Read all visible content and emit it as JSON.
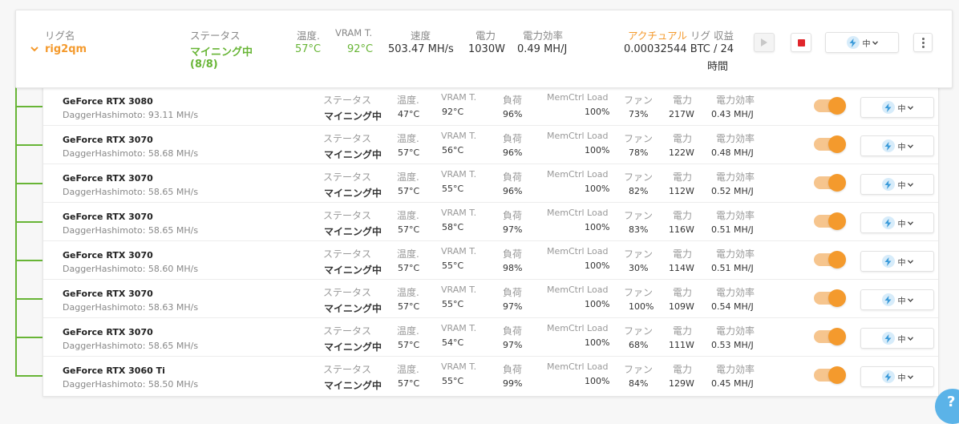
{
  "rig": {
    "name_label": "リグ名",
    "name": "rig2qm",
    "status_label": "ステータス",
    "status": "マイニング中",
    "status_count": "(8/8)",
    "temp_label": "温度.",
    "temp": "57°C",
    "vram_label": "VRAM T.",
    "vram": "92°C",
    "speed_label": "速度",
    "speed": "503.47 MH/s",
    "power_label": "電力",
    "power": "1030W",
    "efficiency_label": "電力効率",
    "efficiency": "0.49 MH/J",
    "profit_label_actual": "アクチュアル",
    "profit_label_rest": " リグ 収益",
    "profit_value": "0.00032544 BTC / 24",
    "profit_unit": "時間",
    "power_mode": "中",
    "play_icon": "play-icon",
    "stop_icon": "stop-icon",
    "more_icon": "vertical-dots-icon"
  },
  "colors": {
    "green": "#68b536",
    "orange": "#f49a2d",
    "stop_red": "#e0252b",
    "bolt_blue": "#3a9ad9"
  },
  "device_labels": {
    "status": "ステータス",
    "temp": "温度.",
    "vram": "VRAM T.",
    "load": "負荷",
    "memctrl": "MemCtrl Load",
    "fan": "ファン",
    "power": "電力",
    "efficiency": "電力効率",
    "power_mode": "中"
  },
  "devices": [
    {
      "name": "GeForce RTX 3080",
      "algo": "DaggerHashimoto: 93.11 MH/s",
      "status": "マイニング中",
      "temp": "47°C",
      "vram": "92°C",
      "load": "96%",
      "memctrl": "100%",
      "fan": "73%",
      "power": "217W",
      "efficiency": "0.43 MH/J"
    },
    {
      "name": "GeForce RTX 3070",
      "algo": "DaggerHashimoto: 58.68 MH/s",
      "status": "マイニング中",
      "temp": "57°C",
      "vram": "56°C",
      "load": "96%",
      "memctrl": "100%",
      "fan": "78%",
      "power": "122W",
      "efficiency": "0.48 MH/J"
    },
    {
      "name": "GeForce RTX 3070",
      "algo": "DaggerHashimoto: 58.65 MH/s",
      "status": "マイニング中",
      "temp": "57°C",
      "vram": "55°C",
      "load": "96%",
      "memctrl": "100%",
      "fan": "82%",
      "power": "112W",
      "efficiency": "0.52 MH/J"
    },
    {
      "name": "GeForce RTX 3070",
      "algo": "DaggerHashimoto: 58.65 MH/s",
      "status": "マイニング中",
      "temp": "57°C",
      "vram": "58°C",
      "load": "97%",
      "memctrl": "100%",
      "fan": "83%",
      "power": "116W",
      "efficiency": "0.51 MH/J"
    },
    {
      "name": "GeForce RTX 3070",
      "algo": "DaggerHashimoto: 58.60 MH/s",
      "status": "マイニング中",
      "temp": "57°C",
      "vram": "55°C",
      "load": "98%",
      "memctrl": "100%",
      "fan": "30%",
      "power": "114W",
      "efficiency": "0.51 MH/J"
    },
    {
      "name": "GeForce RTX 3070",
      "algo": "DaggerHashimoto: 58.63 MH/s",
      "status": "マイニング中",
      "temp": "57°C",
      "vram": "55°C",
      "load": "97%",
      "memctrl": "100%",
      "fan": "100%",
      "power": "109W",
      "efficiency": "0.54 MH/J"
    },
    {
      "name": "GeForce RTX 3070",
      "algo": "DaggerHashimoto: 58.65 MH/s",
      "status": "マイニング中",
      "temp": "57°C",
      "vram": "54°C",
      "load": "97%",
      "memctrl": "100%",
      "fan": "68%",
      "power": "111W",
      "efficiency": "0.53 MH/J"
    },
    {
      "name": "GeForce RTX 3060 Ti",
      "algo": "DaggerHashimoto: 58.50 MH/s",
      "status": "マイニング中",
      "temp": "57°C",
      "vram": "55°C",
      "load": "99%",
      "memctrl": "100%",
      "fan": "84%",
      "power": "129W",
      "efficiency": "0.45 MH/J"
    }
  ],
  "help": {
    "label": "?"
  }
}
